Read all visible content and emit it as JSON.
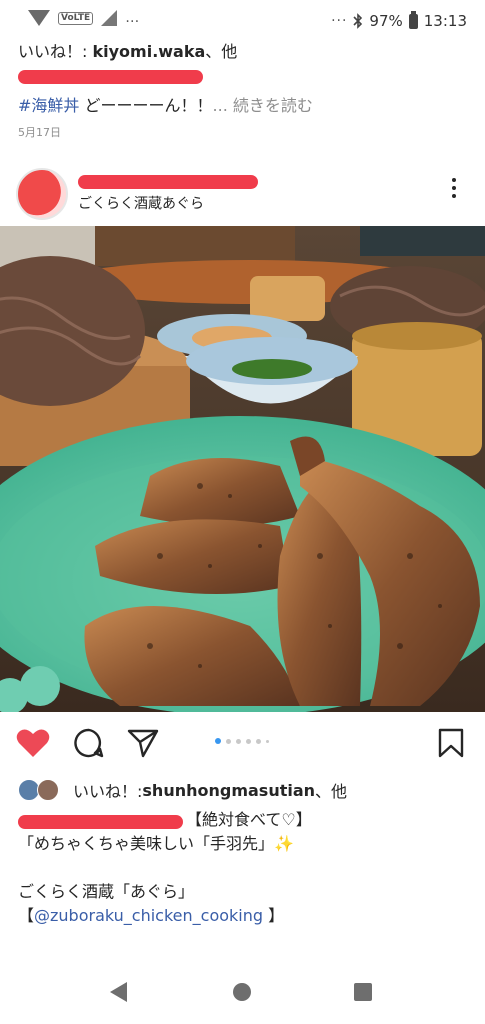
{
  "status_bar": {
    "left_icons": [
      "wifi-icon",
      "volte-lte-icon",
      "signal-icon"
    ],
    "lte_label": "VoLTE",
    "overflow": "…",
    "right_overflow": "···",
    "battery": "97%",
    "time": "13:13"
  },
  "previous_post": {
    "likes_prefix": "いいね！: ",
    "likes_user": "kiyomi.waka",
    "likes_suffix": "、他",
    "hashtag": "#海鮮丼",
    "caption_text": " どーーーーん！！",
    "more_label": "... 続きを読む",
    "date": "5月17日"
  },
  "post": {
    "location": "ごくらく酒蔵あぐら",
    "likes_prefix": "いいね！: ",
    "likes_user": "shunhongmasutian",
    "likes_suffix": "、他",
    "caption_lines": [
      "【絶対食べて♡】",
      "「めちゃくちゃ美味しい「手羽先」✨",
      "",
      "ごくらく酒蔵「あぐら」"
    ],
    "mention_open": "【",
    "mention": "@zuboraku_chicken_cooking",
    "mention_close": " 】",
    "carousel_count": 6,
    "carousel_active": 0
  },
  "colors": {
    "like_red": "#ed4956",
    "link_blue": "#3a5ea8",
    "carousel_active": "#3897f0",
    "redaction": "#ef2b3c"
  }
}
